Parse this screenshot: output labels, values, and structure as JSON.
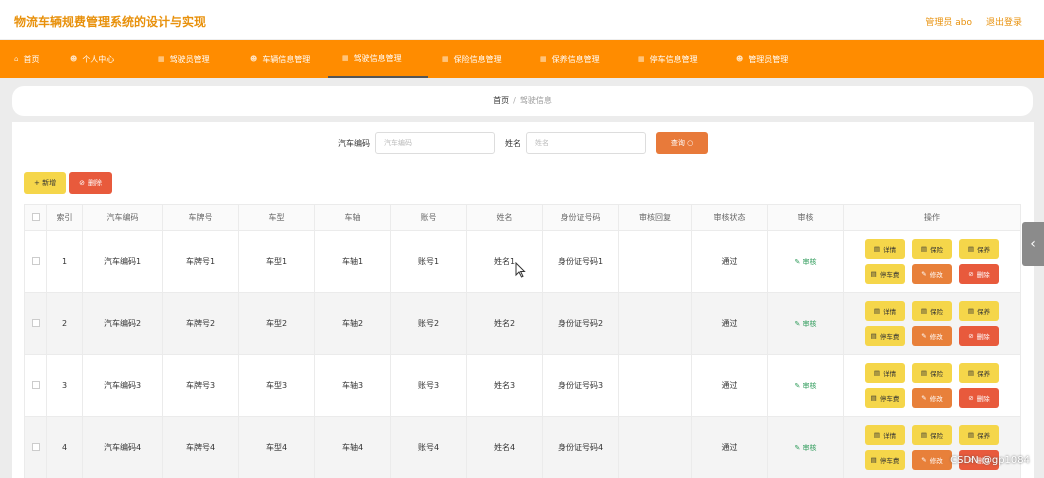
{
  "app_title": "物流车辆规费管理系统的设计与实现",
  "top_right": {
    "user": "管理员 abo",
    "logout": "退出登录"
  },
  "nav": [
    {
      "label": "首页",
      "icon": "home-icon"
    },
    {
      "label": "个人中心",
      "icon": "person-icon"
    },
    {
      "label": "驾驶员管理",
      "icon": "grid-icon"
    },
    {
      "label": "车辆信息管理",
      "icon": "person-icon"
    },
    {
      "label": "驾驶信息管理",
      "icon": "grid-icon"
    },
    {
      "label": "保险信息管理",
      "icon": "grid-icon"
    },
    {
      "label": "保养信息管理",
      "icon": "grid-icon"
    },
    {
      "label": "停车信息管理",
      "icon": "grid-icon"
    },
    {
      "label": "管理员管理",
      "icon": "person-icon"
    }
  ],
  "active_nav": "驾驶信息管理",
  "breadcrumb": {
    "home": "首页",
    "sep": "/",
    "current": "驾驶信息"
  },
  "search": {
    "field1_label": "汽车编码",
    "field1_placeholder": "汽车编码",
    "field2_label": "姓名",
    "field2_placeholder": "姓名",
    "button": "查询"
  },
  "toolbar": {
    "add": "+ 新增",
    "delete": "删除"
  },
  "table": {
    "headers": [
      "索引",
      "汽车编码",
      "车牌号",
      "车型",
      "车轴",
      "账号",
      "姓名",
      "身份证号码",
      "审核回复",
      "审核状态",
      "审核",
      "操作"
    ],
    "rows": [
      {
        "index": "1",
        "code": "汽车编码1",
        "plate": "车牌号1",
        "model": "车型1",
        "axle": "车轴1",
        "account": "账号1",
        "name": "姓名1",
        "id": "身份证号码1",
        "reply": "",
        "status": "通过",
        "audit": "审核"
      },
      {
        "index": "2",
        "code": "汽车编码2",
        "plate": "车牌号2",
        "model": "车型2",
        "axle": "车轴2",
        "account": "账号2",
        "name": "姓名2",
        "id": "身份证号码2",
        "reply": "",
        "status": "通过",
        "audit": "审核"
      },
      {
        "index": "3",
        "code": "汽车编码3",
        "plate": "车牌号3",
        "model": "车型3",
        "axle": "车轴3",
        "account": "账号3",
        "name": "姓名3",
        "id": "身份证号码3",
        "reply": "",
        "status": "通过",
        "audit": "审核"
      },
      {
        "index": "4",
        "code": "汽车编码4",
        "plate": "车牌号4",
        "model": "车型4",
        "axle": "车轴4",
        "account": "账号4",
        "name": "姓名4",
        "id": "身份证号码4",
        "reply": "",
        "status": "通过",
        "audit": "审核"
      }
    ],
    "ops": [
      {
        "label": "详情",
        "style": "yellow",
        "icon": "doc-icon"
      },
      {
        "label": "保险",
        "style": "yellow",
        "icon": "doc-icon"
      },
      {
        "label": "保养",
        "style": "yellow",
        "icon": "doc-icon"
      },
      {
        "label": "停车费",
        "style": "yellow",
        "icon": "doc-icon"
      },
      {
        "label": "修改",
        "style": "orange",
        "icon": "edit-icon"
      },
      {
        "label": "删除",
        "style": "red",
        "icon": "trash-icon"
      }
    ]
  },
  "watermark": "CSDN @gp1084",
  "colors": {
    "brand": "#ff8c00",
    "title": "#e8910c",
    "yellow": "#f5d64a",
    "orange": "#e8803a",
    "red": "#e85a3c",
    "audit": "#2e9b5a"
  }
}
